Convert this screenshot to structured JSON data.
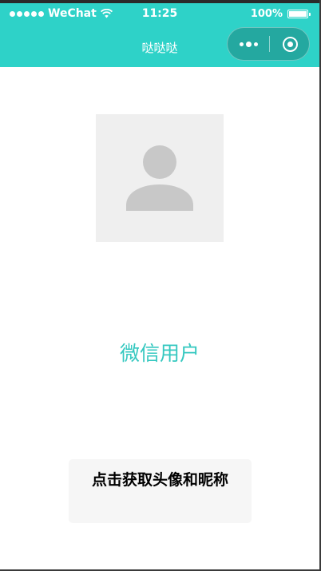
{
  "status_bar": {
    "carrier": "WeChat",
    "time": "11:25",
    "battery": "100%"
  },
  "nav": {
    "title": "哒哒哒"
  },
  "capsule": {
    "more_icon": "more-icon",
    "close_icon": "target-icon"
  },
  "profile": {
    "avatar_icon": "default-user-icon",
    "nickname": "微信用户"
  },
  "actions": {
    "get_profile_label": "点击获取头像和昵称"
  },
  "colors": {
    "nav_bg": "#2ed2c8",
    "nickname": "#35c8c0",
    "button_bg": "#f6f6f6",
    "avatar_bg": "#efefef"
  }
}
